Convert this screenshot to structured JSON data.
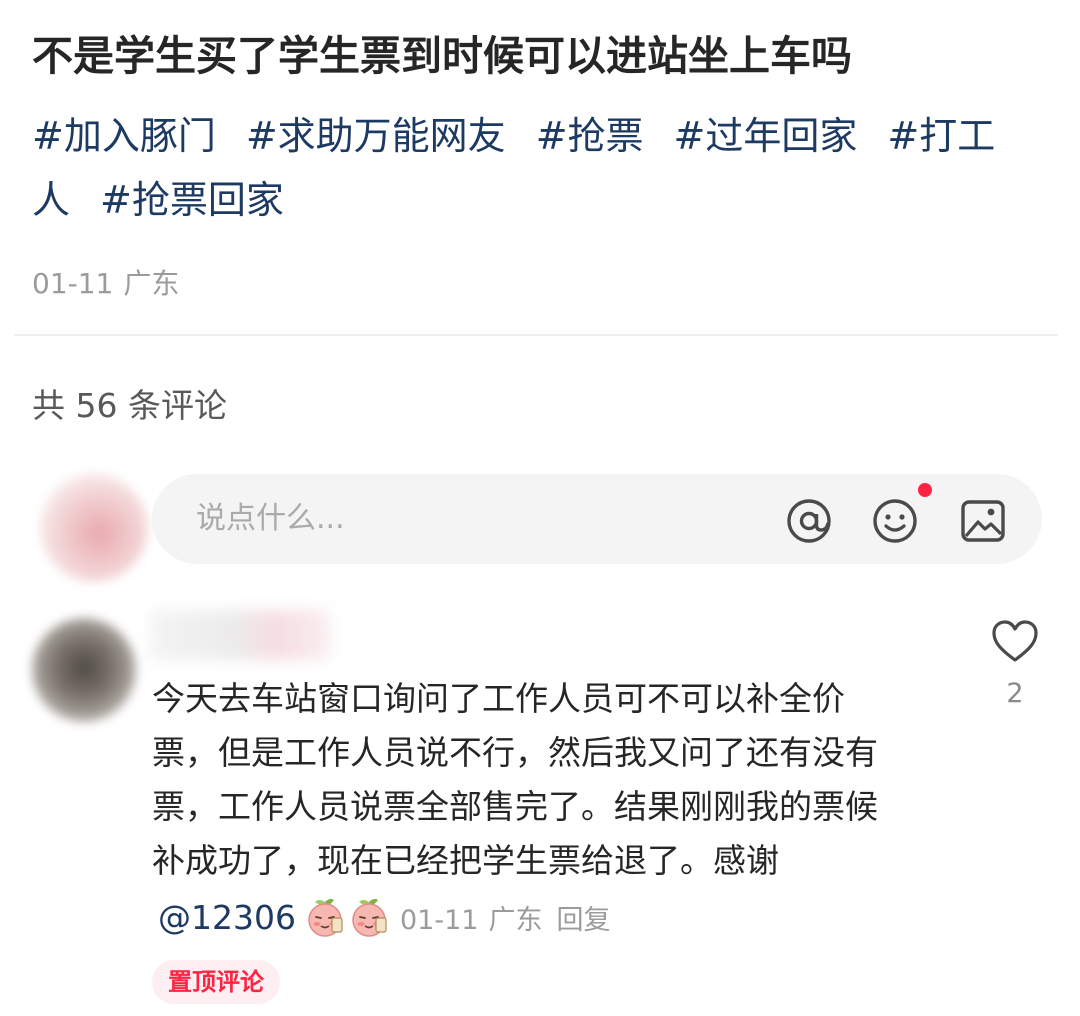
{
  "post": {
    "title": "不是学生买了学生票到时候可以进站坐上车吗",
    "tags": [
      "#加入豚门",
      "#求助万能网友",
      "#抢票",
      "#过年回家",
      "#打工人",
      "#抢票回家"
    ],
    "date": "01-11",
    "location": "广东"
  },
  "comments_section": {
    "count_label": "共 56 条评论",
    "input": {
      "placeholder": "说点什么...",
      "icons": [
        "at-icon",
        "emoji-icon",
        "image-icon"
      ],
      "has_notification": true
    }
  },
  "comment": {
    "lines": [
      "今天去车站窗口询问了工作人员可不可以补全价",
      "票，但是工作人员说不行，然后我又问了还有没有",
      "票，工作人员说票全部售完了。结果刚刚我的票候",
      "补成功了，现在已经把学生票给退了。感谢"
    ],
    "mention": "@12306",
    "date": "01-11",
    "location": "广东",
    "reply_label": "回复",
    "pinned_label": "置顶评论",
    "like_count": "2"
  },
  "colors": {
    "accent": "#ff2442",
    "tag_link": "#1d3a63",
    "meta_gray": "#9b9b9b",
    "input_bg": "#f4f4f5"
  }
}
